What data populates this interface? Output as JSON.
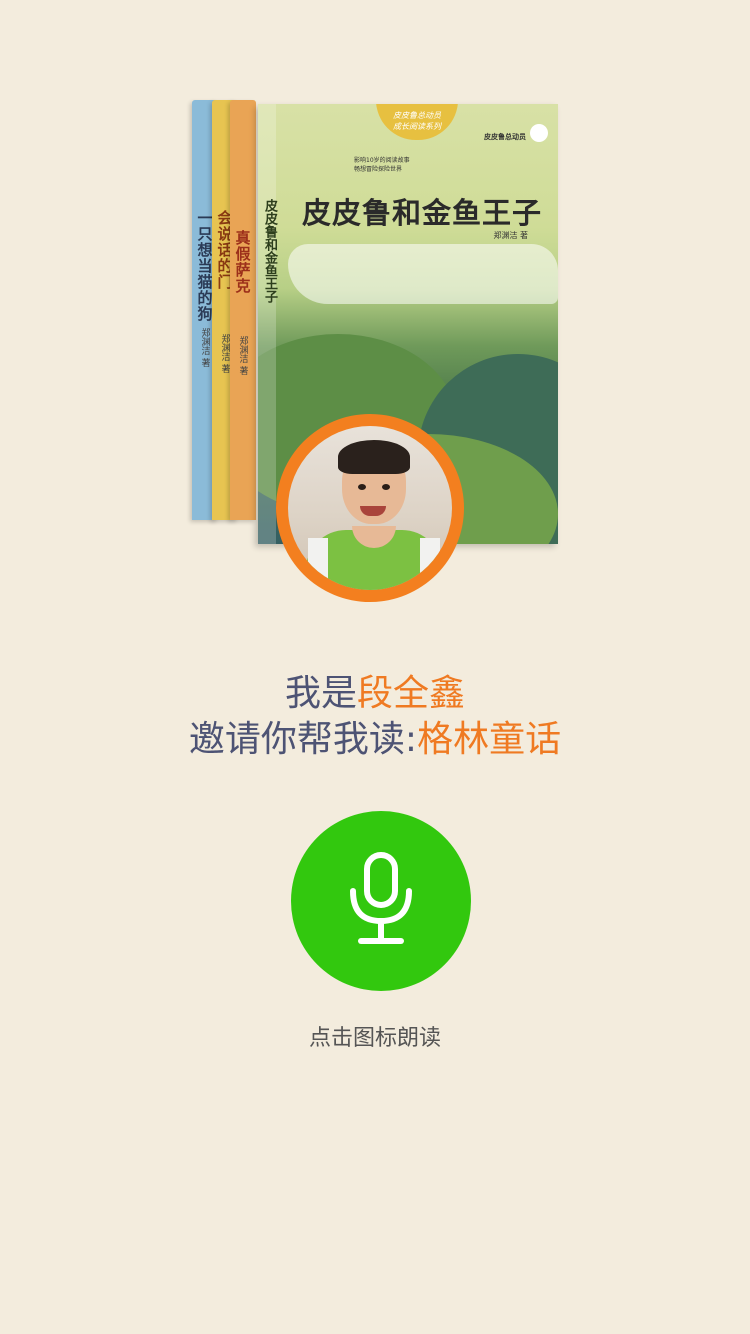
{
  "books": {
    "spines": [
      {
        "title": "一只想当猫的狗",
        "author": "郑渊洁 著",
        "color": "#8bbbd8"
      },
      {
        "title": "会说话的门",
        "author": "郑渊洁 著",
        "color": "#e7c451"
      },
      {
        "title": "真假萨克",
        "author": "郑渊洁 著",
        "color": "#e9a455"
      }
    ],
    "cover": {
      "badge_line1": "皮皮鲁总动员",
      "badge_line2": "成长阅读系列",
      "brand": "皮皮鲁总动员",
      "blurb_line1": "影响10岁的阅读故事",
      "blurb_line2": "畅想冒险探险世界",
      "title": "皮皮鲁和金鱼王子",
      "spine_title": "皮皮鲁和金鱼王子",
      "author": "郑渊洁 著"
    }
  },
  "avatar": {
    "label": "child-photo"
  },
  "intro": {
    "line1_prefix": "我是",
    "name": "段全鑫",
    "line2_prefix": "邀请你帮我读:",
    "book_title": "格林童话"
  },
  "mic": {
    "icon": "microphone-icon",
    "hint": "点击图标朗读"
  },
  "colors": {
    "background": "#f3ecdd",
    "accent": "#ef7a22",
    "text": "#4d5374",
    "mic_green": "#32c80e",
    "avatar_ring": "#f37f1f"
  }
}
